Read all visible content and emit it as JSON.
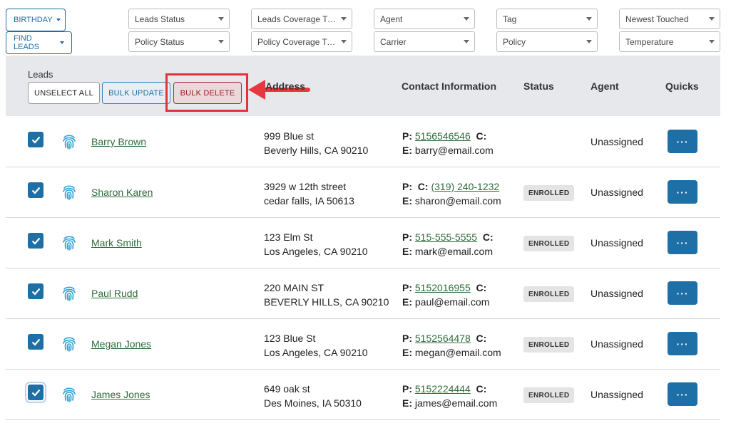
{
  "top_buttons": {
    "birthday": "BIRTHDAY",
    "find_leads": "FIND LEADS"
  },
  "filters": {
    "leads_status": "Leads Status",
    "leads_coverage_type": "Leads Coverage Type",
    "agent": "Agent",
    "tag": "Tag",
    "newest_touched": "Newest Touched",
    "policy_status": "Policy Status",
    "policy_coverage_type": "Policy Coverage Ty...",
    "carrier": "Carrier",
    "policy": "Policy",
    "temperature": "Temperature"
  },
  "header": {
    "leads_label": "Leads",
    "unselect_all": "UNSELECT ALL",
    "bulk_update": "BULK UPDATE",
    "bulk_delete": "BULK DELETE",
    "columns": {
      "address": "Address",
      "contact": "Contact Information",
      "status": "Status",
      "agent": "Agent",
      "quicks": "Quicks"
    }
  },
  "rows": [
    {
      "name": "Barry Brown",
      "addr1": "999 Blue st",
      "addr2": "Beverly Hills, CA 90210",
      "p_label": "P:",
      "phone": "5156546546",
      "c_label": "C:",
      "cell": "",
      "e_label": "E:",
      "email": "barry@email.com",
      "status": "",
      "agent": "Unassigned",
      "quick": "···"
    },
    {
      "name": "Sharon Karen",
      "addr1": "3929 w 12th street",
      "addr2": "cedar falls, IA 50613",
      "p_label": "P:",
      "phone": "",
      "c_label": "C:",
      "cell": "(319) 240-1232",
      "e_label": "E:",
      "email": "sharon@email.com",
      "status": "ENROLLED",
      "agent": "Unassigned",
      "quick": "···"
    },
    {
      "name": "Mark Smith",
      "addr1": "123 Elm St",
      "addr2": "Los Angeles, CA 90210",
      "p_label": "P:",
      "phone": "515-555-5555",
      "c_label": "C:",
      "cell": "",
      "e_label": "E:",
      "email": "mark@email.com",
      "status": "ENROLLED",
      "agent": "Unassigned",
      "quick": "···"
    },
    {
      "name": "Paul Rudd",
      "addr1": "220 MAIN ST",
      "addr2": "BEVERLY HILLS, CA 90210",
      "p_label": "P:",
      "phone": "5152016955",
      "c_label": "C:",
      "cell": "",
      "e_label": "E:",
      "email": "paul@email.com",
      "status": "ENROLLED",
      "agent": "Unassigned",
      "quick": "···"
    },
    {
      "name": "Megan Jones",
      "addr1": "123 Blue St",
      "addr2": "Los Angeles, CA 90210",
      "p_label": "P:",
      "phone": "5152564478",
      "c_label": "C:",
      "cell": "",
      "e_label": "E:",
      "email": "megan@email.com",
      "status": "ENROLLED",
      "agent": "Unassigned",
      "quick": "···"
    },
    {
      "name": "James Jones",
      "addr1": "649 oak st",
      "addr2": "Des Moines, IA 50310",
      "p_label": "P:",
      "phone": "5152224444",
      "c_label": "C:",
      "cell": "",
      "e_label": "E:",
      "email": "james@email.com",
      "status": "ENROLLED",
      "agent": "Unassigned",
      "quick": "···"
    }
  ],
  "colors": {
    "primary": "#1d6fa5",
    "danger": "#b02a30",
    "link": "#2f6b3a",
    "annotation": "#e0333a"
  }
}
